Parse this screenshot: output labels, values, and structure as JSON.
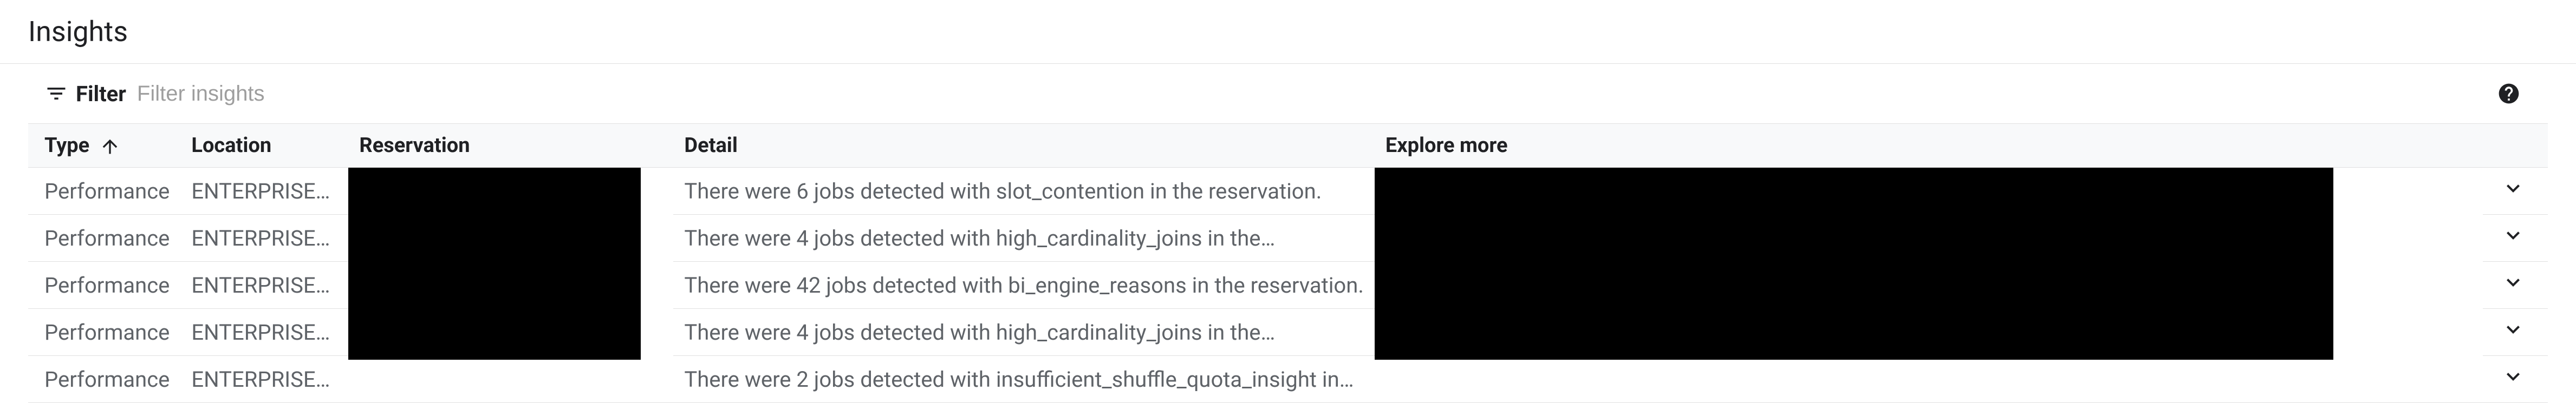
{
  "page": {
    "title": "Insights"
  },
  "filter": {
    "label": "Filter",
    "placeholder": "Filter insights"
  },
  "columns": {
    "type": "Type",
    "location": "Location",
    "reservation": "Reservation",
    "detail": "Detail",
    "explore": "Explore more"
  },
  "rows": [
    {
      "type": "Performance",
      "location": "ENTERPRISE…",
      "detail": "There were 6 jobs detected with slot_contention in the reservation."
    },
    {
      "type": "Performance",
      "location": "ENTERPRISE…",
      "detail": "There were 4 jobs detected with high_cardinality_joins in the…"
    },
    {
      "type": "Performance",
      "location": "ENTERPRISE…",
      "detail": "There were 42 jobs detected with bi_engine_reasons in the reservation."
    },
    {
      "type": "Performance",
      "location": "ENTERPRISE…",
      "detail": "There were 4 jobs detected with high_cardinality_joins in the…"
    },
    {
      "type": "Performance",
      "location": "ENTERPRISE…",
      "detail": "There were 2 jobs detected with insufficient_shuffle_quota_insight in…"
    }
  ]
}
